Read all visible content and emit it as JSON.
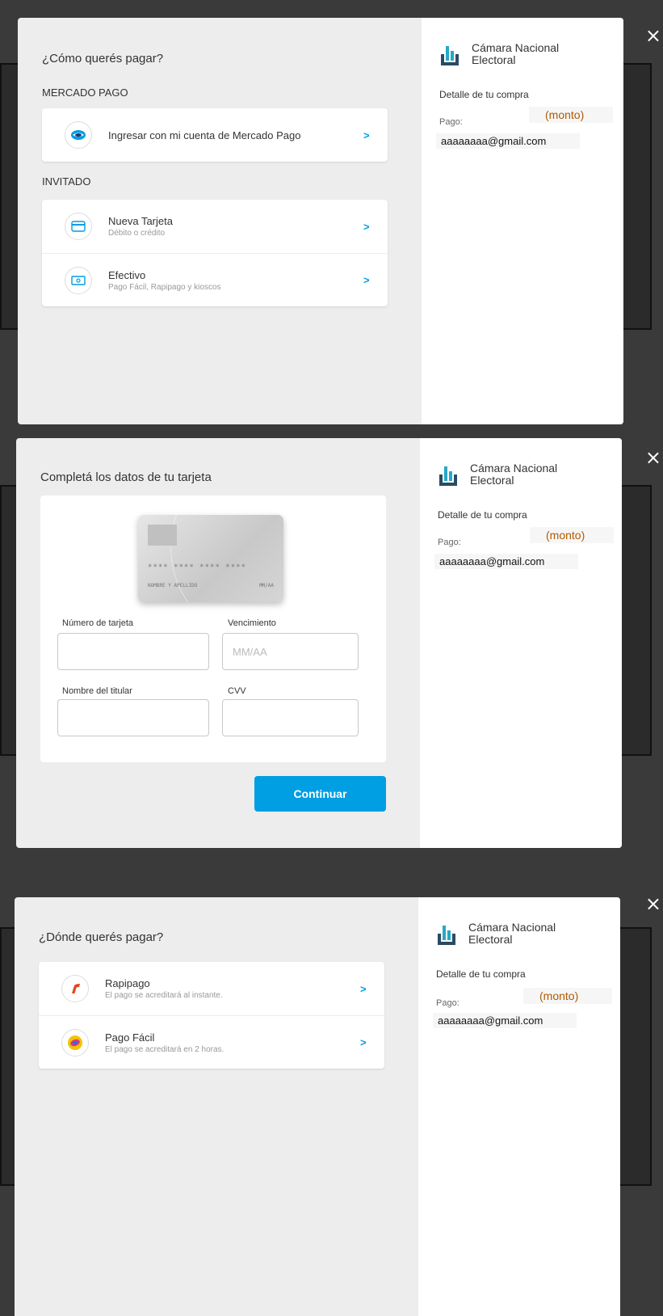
{
  "close_icon_glyph": "×",
  "merchant": {
    "name_line1": "Cámara Nacional",
    "name_line2": "Electoral",
    "logo_icon": "building-icon"
  },
  "summary": {
    "detail_title": "Detalle de tu compra",
    "pago_label": "Pago:",
    "monto": "(monto)",
    "email": "aaaaaaaa@gmail.com"
  },
  "screen1": {
    "heading": "¿Cómo querés pagar?",
    "section_mp": "MERCADO PAGO",
    "mp_option": {
      "title": "Ingresar con mi cuenta de Mercado Pago",
      "icon": "handshake-icon"
    },
    "section_guest": "INVITADO",
    "guest_options": [
      {
        "title": "Nueva Tarjeta",
        "subtitle": "Débito o crédito",
        "icon": "credit-card-icon"
      },
      {
        "title": "Efectivo",
        "subtitle": "Pago Fácil, Rapipago y kioscos",
        "icon": "cash-icon"
      }
    ],
    "chevron": ">"
  },
  "screen2": {
    "heading": "Completá los datos de tu tarjeta",
    "card_preview": {
      "number": "**** **** **** ****",
      "name": "NOMBRE Y APELLIDO",
      "expiry": "MM/AA"
    },
    "fields": {
      "number_label": "Número de tarjeta",
      "expiry_label": "Vencimiento",
      "expiry_placeholder": "MM/AA",
      "holder_label": "Nombre del titular",
      "cvv_label": "CVV"
    },
    "continue_label": "Continuar"
  },
  "screen3": {
    "heading": "¿Dónde querés pagar?",
    "options": [
      {
        "title": "Rapipago",
        "subtitle": "El pago se acreditará al instante.",
        "icon": "rapipago-logo-icon"
      },
      {
        "title": "Pago Fácil",
        "subtitle": "El pago se acreditará en 2 horas.",
        "icon": "pagofacil-logo-icon"
      }
    ]
  },
  "colors": {
    "accent": "#009ee3",
    "monto": "#b15a00"
  }
}
